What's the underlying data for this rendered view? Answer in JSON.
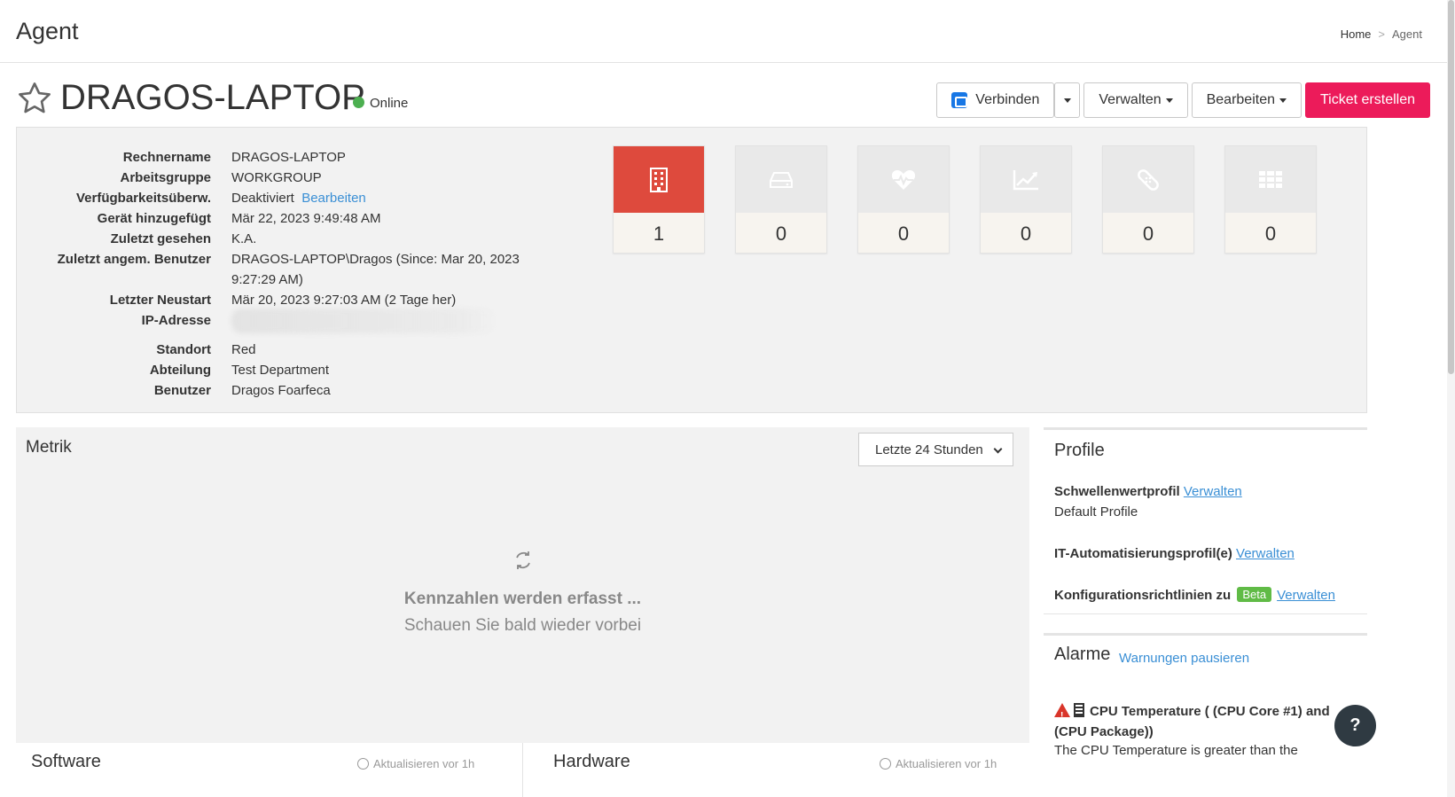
{
  "header": {
    "title": "Agent",
    "breadcrumb": {
      "home": "Home",
      "separator": ">",
      "current": "Agent"
    }
  },
  "device": {
    "name": "DRAGOS-LAPTOP",
    "status": "Online",
    "status_color": "#4caf50"
  },
  "actions": {
    "connect": "Verbinden",
    "manage": "Verwalten",
    "edit": "Bearbeiten",
    "create_ticket": "Ticket erstellen",
    "primary_color": "#ec1b5a"
  },
  "details": {
    "computer_name": {
      "label": "Rechnername",
      "value": "DRAGOS-LAPTOP"
    },
    "workgroup": {
      "label": "Arbeitsgruppe",
      "value": "WORKGROUP"
    },
    "availability": {
      "label": "Verfügbarkeitsüberw.",
      "value": "Deaktiviert",
      "link": "Bearbeiten"
    },
    "added": {
      "label": "Gerät hinzugefügt",
      "value": "Mär 22, 2023 9:49:48 AM"
    },
    "last_seen": {
      "label": "Zuletzt gesehen",
      "value": "K.A."
    },
    "last_user": {
      "label": "Zuletzt angem. Benutzer",
      "value": "DRAGOS-LAPTOP\\Dragos (Since: Mar 20, 2023 9:27:29 AM)"
    },
    "last_reboot": {
      "label": "Letzter Neustart",
      "value": "Mär 20, 2023 9:27:03 AM (2 Tage her)"
    },
    "ip": {
      "label": "IP-Adresse",
      "value": ""
    },
    "location": {
      "label": "Standort",
      "value": "Red"
    },
    "department": {
      "label": "Abteilung",
      "value": "Test Department"
    },
    "user": {
      "label": "Benutzer",
      "value": "Dragos Foarfeca"
    }
  },
  "tiles": [
    {
      "icon": "building-icon",
      "count": "1",
      "color": "#de4a3d"
    },
    {
      "icon": "drive-icon",
      "count": "0"
    },
    {
      "icon": "heartbeat-icon",
      "count": "0"
    },
    {
      "icon": "chart-icon",
      "count": "0"
    },
    {
      "icon": "patch-icon",
      "count": "0"
    },
    {
      "icon": "grid-icon",
      "count": "0"
    }
  ],
  "metrics": {
    "title": "Metrik",
    "range": "Letzte 24 Stunden",
    "loading_title": "Kennzahlen werden erfasst ...",
    "loading_sub": "Schauen Sie bald wieder vorbei"
  },
  "subpanels": {
    "software": {
      "title": "Software",
      "refresh": "Aktualisieren vor 1h "
    },
    "hardware": {
      "title": "Hardware",
      "refresh": "Aktualisieren vor 1h "
    }
  },
  "profile": {
    "title": "Profile",
    "threshold_label": "Schwellenwertprofil",
    "threshold_link": "Verwalten",
    "threshold_value": "Default Profile",
    "automation_label": "IT-Automatisierungsprofil(e)",
    "automation_link": "Verwalten",
    "config_label": "Konfigurationsrichtlinien zu",
    "config_badge": "Beta",
    "config_link": "Verwalten"
  },
  "alarms": {
    "title": "Alarme",
    "pause": "Warnungen pausieren",
    "item_title": "CPU Temperature ( (CPU Core #1) and (CPU Package))",
    "item_desc": "The CPU Temperature is greater than the"
  },
  "help": "?"
}
